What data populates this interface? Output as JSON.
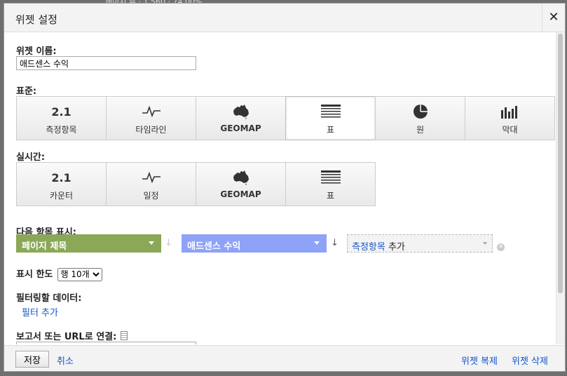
{
  "dialog": {
    "title": "위젯 설정",
    "close_glyph": "✕"
  },
  "widget_name": {
    "label": "위젯 이름:",
    "value": "애드센스 수익"
  },
  "standard": {
    "label": "표준:",
    "options": [
      {
        "icon": "2.1",
        "label": "측정항목"
      },
      {
        "icon": "timeline-icon",
        "label": "타임라인"
      },
      {
        "icon": "australia-map-icon",
        "label": "GEOMAP"
      },
      {
        "icon": "table-icon",
        "label": "표",
        "selected": true
      },
      {
        "icon": "pie-icon",
        "label": "원"
      },
      {
        "icon": "bar-chart-icon",
        "label": "막대"
      }
    ]
  },
  "realtime": {
    "label": "실시간:",
    "options": [
      {
        "icon": "2.1",
        "label": "카운터"
      },
      {
        "icon": "timeline-icon",
        "label": "일정"
      },
      {
        "icon": "australia-map-icon",
        "label": "GEOMAP"
      },
      {
        "icon": "table-icon",
        "label": "표"
      }
    ]
  },
  "display": {
    "label": "다음 항목 표시:",
    "dimension": "페이지 제목",
    "dimension_color": "#8aa858",
    "metric": "애드센스 수익",
    "metric_color": "#8ea2f7",
    "add_metric_link": "측정항목",
    "add_metric_suffix": " 추가"
  },
  "limit": {
    "label": "표시 한도",
    "value": "행 10개"
  },
  "filter": {
    "label": "필터링할 데이터:",
    "add_filter": "필터 추가"
  },
  "link_report": {
    "label": "보고서 또는 URL로 연결:"
  },
  "footer": {
    "save": "저장",
    "cancel": "취소",
    "clone": "위젯 복제",
    "delete": "위젯 삭제"
  }
}
